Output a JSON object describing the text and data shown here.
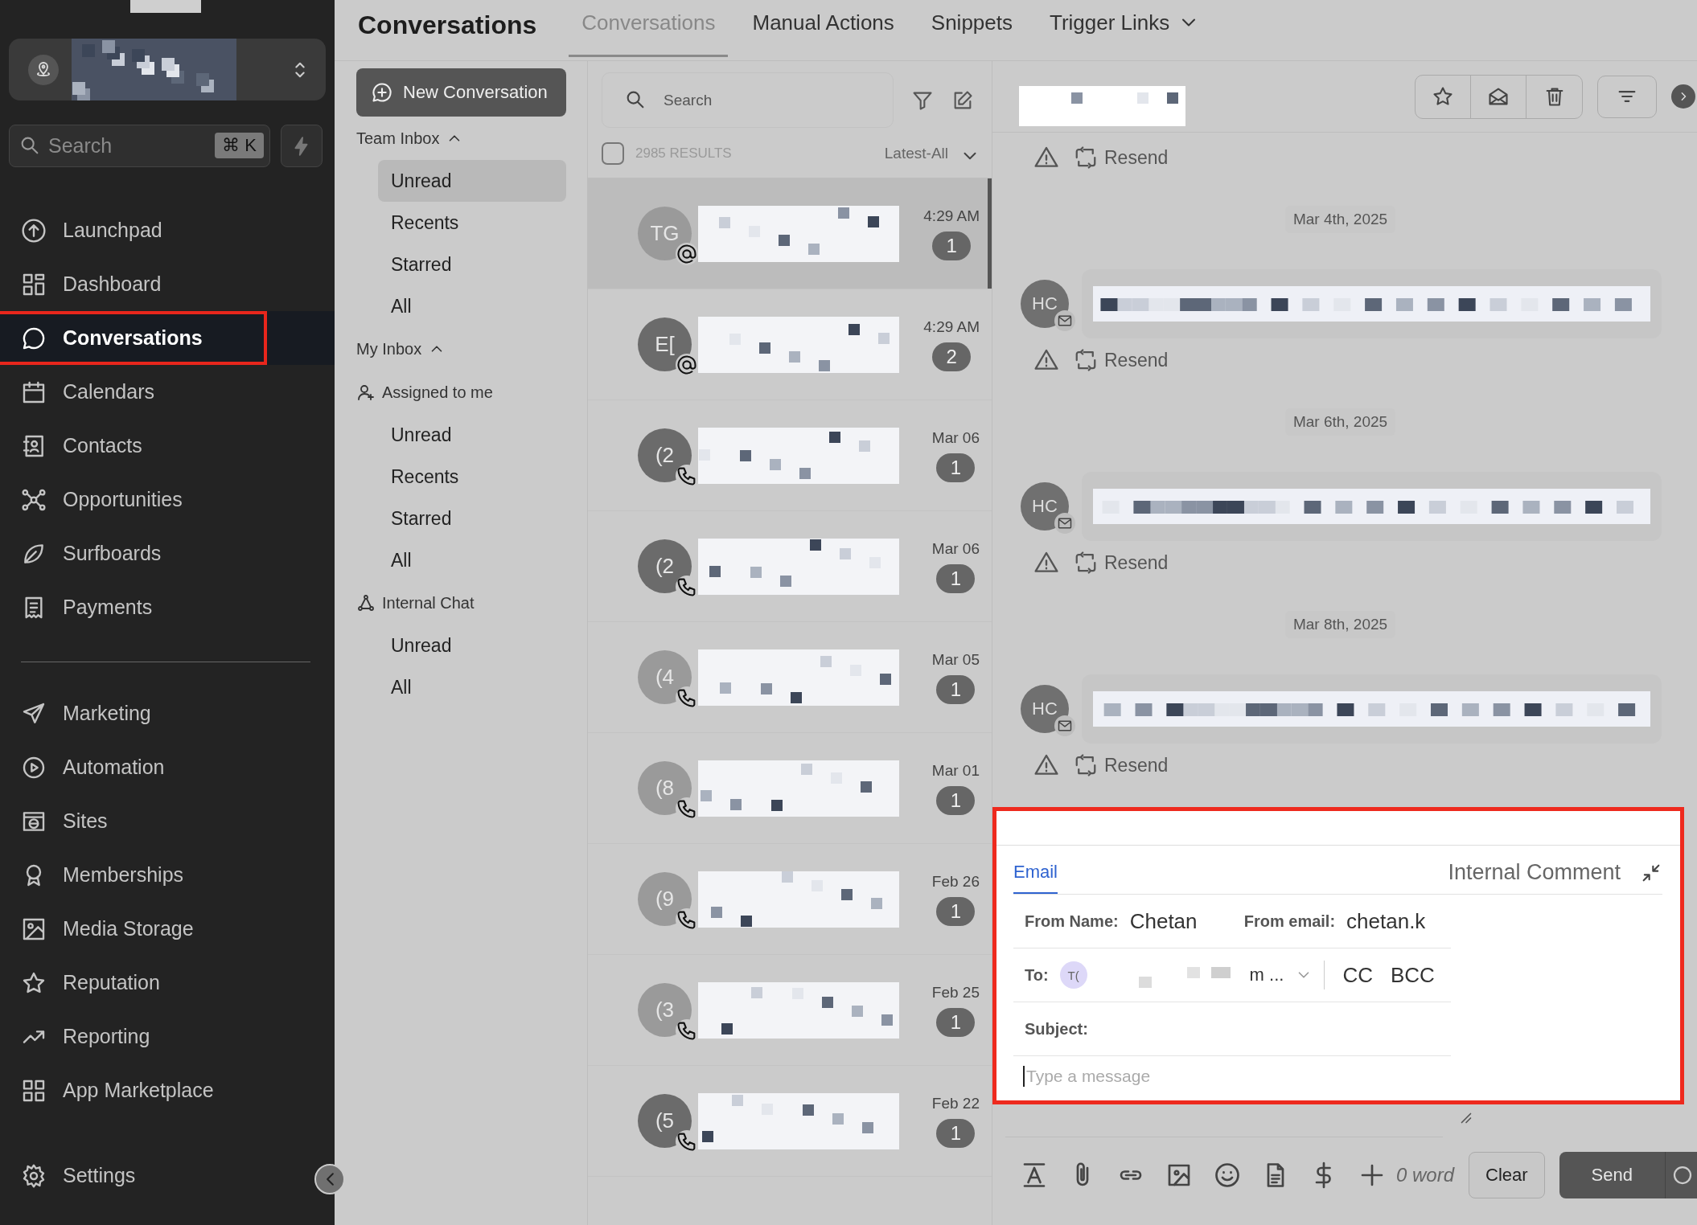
{
  "sidebar": {
    "search": {
      "placeholder": "Search",
      "shortcut": "⌘ K"
    },
    "nav_items": [
      {
        "label": "Launchpad",
        "selected": false,
        "highlighted": false
      },
      {
        "label": "Dashboard",
        "selected": false,
        "highlighted": false
      },
      {
        "label": "Conversations",
        "selected": true,
        "highlighted": true
      },
      {
        "label": "Calendars",
        "selected": false,
        "highlighted": false
      },
      {
        "label": "Contacts",
        "selected": false,
        "highlighted": false
      },
      {
        "label": "Opportunities",
        "selected": false,
        "highlighted": false
      },
      {
        "label": "Surfboards",
        "selected": false,
        "highlighted": false
      },
      {
        "label": "Payments",
        "selected": false,
        "highlighted": false
      }
    ],
    "tool_items": [
      {
        "label": "Marketing",
        "selected": false
      },
      {
        "label": "Automation",
        "selected": false
      },
      {
        "label": "Sites",
        "selected": false
      },
      {
        "label": "Memberships",
        "selected": false
      },
      {
        "label": "Media Storage",
        "selected": false
      },
      {
        "label": "Reputation",
        "selected": false
      },
      {
        "label": "Reporting",
        "selected": false
      },
      {
        "label": "App Marketplace",
        "selected": false
      }
    ],
    "settings": {
      "label": "Settings",
      "selected": false
    }
  },
  "header": {
    "title": "Conversations",
    "tabs": [
      {
        "label": "Conversations",
        "selected": true,
        "dropdown": false
      },
      {
        "label": "Manual Actions",
        "selected": false,
        "dropdown": false
      },
      {
        "label": "Snippets",
        "selected": false,
        "dropdown": false
      },
      {
        "label": "Trigger Links",
        "selected": false,
        "dropdown": true
      }
    ]
  },
  "inbox_nav": {
    "new_conversation": "New Conversation",
    "groups": [
      {
        "label": "Team Inbox",
        "kind": "collapsible",
        "expanded": true,
        "items": [
          {
            "label": "Unread",
            "selected": true
          },
          {
            "label": "Recents",
            "selected": false
          },
          {
            "label": "Starred",
            "selected": false
          },
          {
            "label": "All",
            "selected": false
          }
        ]
      },
      {
        "label": "My Inbox",
        "kind": "collapsible",
        "expanded": true
      },
      {
        "label": "Assigned to me",
        "kind": "person",
        "items": [
          {
            "label": "Unread",
            "selected": false
          },
          {
            "label": "Recents",
            "selected": false
          },
          {
            "label": "Starred",
            "selected": false
          },
          {
            "label": "All",
            "selected": false
          }
        ]
      },
      {
        "label": "Internal Chat",
        "kind": "chat",
        "items": [
          {
            "label": "Unread",
            "selected": false
          },
          {
            "label": "All",
            "selected": false
          }
        ]
      }
    ]
  },
  "conversation_list": {
    "search": {
      "placeholder": "Search"
    },
    "select_all": {
      "checked": false
    },
    "results": "2985 RESULTS",
    "sort": "Latest-All",
    "rows": [
      {
        "initials": "TG",
        "kind": "email",
        "time": "4:29 AM",
        "count": "1",
        "selected": true,
        "color": "#9a9a9a"
      },
      {
        "initials": "E[",
        "kind": "email",
        "time": "4:29 AM",
        "count": "2",
        "selected": false,
        "color": "#6b6b6b"
      },
      {
        "initials": "(2",
        "kind": "phone",
        "time": "Mar 06",
        "count": "1",
        "selected": false,
        "color": "#6b6b6b"
      },
      {
        "initials": "(2",
        "kind": "phone",
        "time": "Mar 06",
        "count": "1",
        "selected": false,
        "color": "#6b6b6b"
      },
      {
        "initials": "(4",
        "kind": "phone",
        "time": "Mar 05",
        "count": "1",
        "selected": false,
        "color": "#9a9a9a"
      },
      {
        "initials": "(8",
        "kind": "phone",
        "time": "Mar 01",
        "count": "1",
        "selected": false,
        "color": "#9a9a9a"
      },
      {
        "initials": "(9",
        "kind": "phone",
        "time": "Feb 26",
        "count": "1",
        "selected": false,
        "color": "#9a9a9a"
      },
      {
        "initials": "(3",
        "kind": "phone",
        "time": "Feb 25",
        "count": "1",
        "selected": false,
        "color": "#9a9a9a"
      },
      {
        "initials": "(5",
        "kind": "phone",
        "time": "Feb 22",
        "count": "1",
        "selected": false,
        "color": "#6b6b6b"
      }
    ]
  },
  "thread": {
    "items": [
      {
        "kind": "status",
        "action": "Resend"
      },
      {
        "kind": "date",
        "text": "Mar 4th, 2025"
      },
      {
        "kind": "message",
        "initials": "HC"
      },
      {
        "kind": "status",
        "action": "Resend"
      },
      {
        "kind": "date",
        "text": "Mar 6th, 2025"
      },
      {
        "kind": "message",
        "initials": "HC"
      },
      {
        "kind": "status",
        "action": "Resend"
      },
      {
        "kind": "date",
        "text": "Mar 8th, 2025"
      },
      {
        "kind": "message",
        "initials": "HC"
      },
      {
        "kind": "status",
        "action": "Resend"
      }
    ]
  },
  "composer": {
    "highlighted": true,
    "tabs": [
      {
        "label": "Email",
        "selected": true
      },
      {
        "label": "Internal Comment",
        "selected": false
      }
    ],
    "from_name_label": "From Name:",
    "from_name": "Chetan",
    "from_email_label": "From email:",
    "from_email": "chetan.k",
    "to_label": "To:",
    "to_chip": "T(",
    "to_tail": "m ...",
    "cc": "CC",
    "bcc": "BCC",
    "subject_label": "Subject:",
    "message_placeholder": "Type a message",
    "word_count": "0 word",
    "clear": "Clear",
    "send": "Send"
  }
}
